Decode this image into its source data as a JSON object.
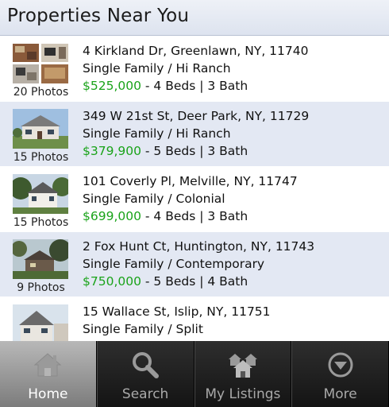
{
  "header": {
    "title": "Properties Near You"
  },
  "listings": [
    {
      "address": "4 Kirkland Dr, Greenlawn, NY, 11740",
      "type": "Single Family / Hi Ranch",
      "price": "$525,000",
      "details": " - 4 Beds | 3 Bath",
      "photos": "20 Photos"
    },
    {
      "address": "349 W 21st St, Deer Park, NY, 11729",
      "type": "Single Family / Hi Ranch",
      "price": "$379,900",
      "details": " - 5 Beds | 3 Bath",
      "photos": "15 Photos"
    },
    {
      "address": "101 Coverly Pl, Melville, NY, 11747",
      "type": "Single Family / Colonial",
      "price": "$699,000",
      "details": " - 4 Beds | 3 Bath",
      "photos": "15 Photos"
    },
    {
      "address": "2 Fox Hunt Ct, Huntington, NY, 11743",
      "type": "Single Family / Contemporary",
      "price": "$750,000",
      "details": " - 5 Beds | 4 Bath",
      "photos": "9 Photos"
    },
    {
      "address": "15 Wallace St, Islip, NY, 11751",
      "type": "Single Family / Split",
      "price": "",
      "details": "",
      "photos": ""
    }
  ],
  "tabs": [
    {
      "label": "Home",
      "icon": "home-icon",
      "active": true
    },
    {
      "label": "Search",
      "icon": "magnifier-icon",
      "active": false
    },
    {
      "label": "My Listings",
      "icon": "houses-icon",
      "active": false
    },
    {
      "label": "More",
      "icon": "chevron-down-circle-icon",
      "active": false
    }
  ],
  "colors": {
    "price": "#1aa31a",
    "header_bg": "#dde3ef",
    "row_alt": "#e3e8f3"
  }
}
